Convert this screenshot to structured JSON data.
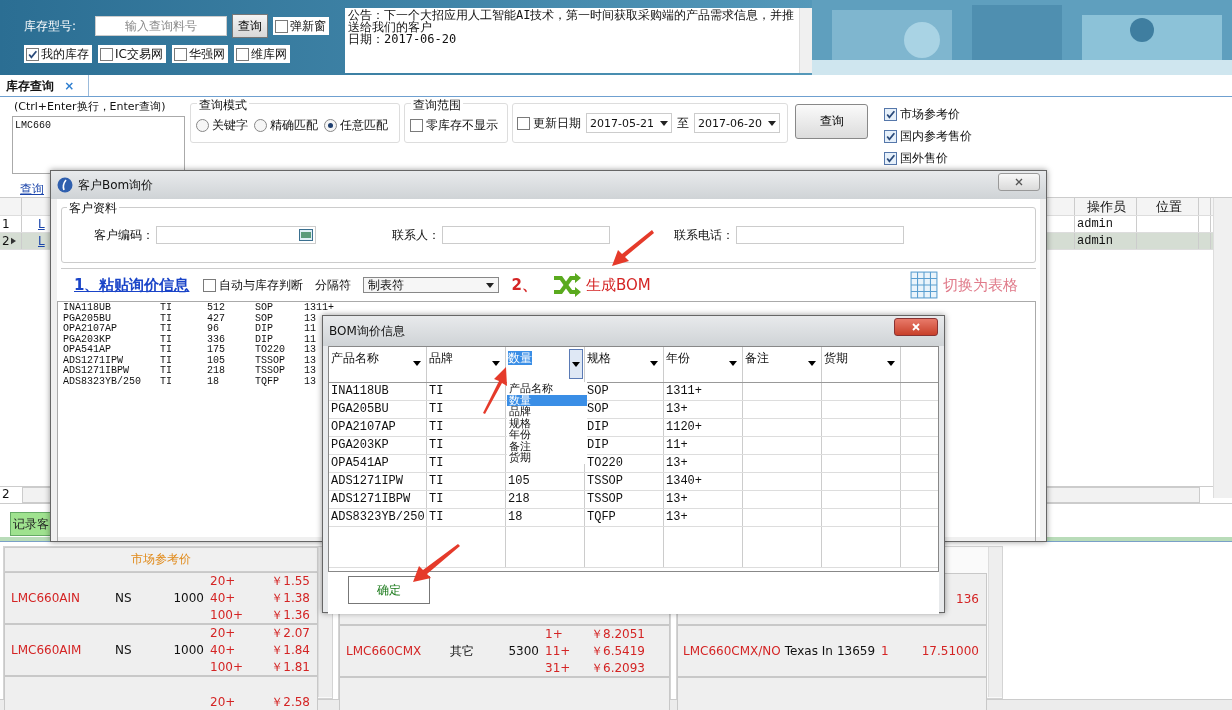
{
  "banner": {
    "model_label": "库存型号:",
    "search": {
      "placeholder": "输入查询料号"
    },
    "search_button": "查询",
    "popup": {
      "label": "弹新窗",
      "checked": false
    },
    "sources": [
      {
        "label": "我的库存",
        "checked": true
      },
      {
        "label": "IC交易网",
        "checked": false
      },
      {
        "label": "华强网",
        "checked": false
      },
      {
        "label": "维库网",
        "checked": false
      }
    ],
    "notice": "公告：下一个大招应用人工智能AI技术，第一时间获取采购端的产品需求信息，并推送给我们的客户",
    "notice_date": "日期：2017-06-20"
  },
  "tabs": [
    {
      "label": "库存查询",
      "selected": true,
      "close": "×"
    }
  ],
  "query": {
    "hint": "(Ctrl+Enter换行，Enter查询)",
    "input": "LMC660",
    "history_link": "查询",
    "mode": {
      "title": "查询模式",
      "options": [
        {
          "label": "关键字",
          "selected": false
        },
        {
          "label": "精确匹配",
          "selected": false
        },
        {
          "label": "任意匹配",
          "selected": true
        }
      ]
    },
    "scope": {
      "title": "查询范围",
      "zero_hidden": {
        "label": "零库存不显示",
        "checked": false
      }
    },
    "date": {
      "label": "更新日期",
      "checked": false,
      "from": "2017-05-21",
      "sep": "至",
      "to": "2017-06-20"
    },
    "button": "查询",
    "price_options": [
      {
        "label": "市场参考价",
        "checked": true
      },
      {
        "label": "国内参考售价",
        "checked": true
      },
      {
        "label": "国外售价",
        "checked": true
      }
    ]
  },
  "grid": {
    "columns": [
      "操作员",
      "位置"
    ],
    "rows": [
      {
        "number": "1",
        "part": "L",
        "operator": "admin",
        "selected": false
      },
      {
        "number": "2",
        "part": "L",
        "operator": "admin",
        "selected": true
      }
    ],
    "footer": "2"
  },
  "record_button": "记录客",
  "bottom": {
    "market": {
      "title": "市场参考价",
      "rows": [
        {
          "name": "LMC660AIN",
          "brand": "NS",
          "qty": "1000",
          "tiers": [
            {
              "qty": "20+",
              "price": "￥1.55"
            },
            {
              "qty": "40+",
              "price": "￥1.38"
            },
            {
              "qty": "100+",
              "price": "￥1.36"
            }
          ]
        },
        {
          "name": "LMC660AIM",
          "brand": "NS",
          "qty": "1000",
          "tiers": [
            {
              "qty": "20+",
              "price": "￥2.07"
            },
            {
              "qty": "40+",
              "price": "￥1.84"
            },
            {
              "qty": "100+",
              "price": "￥1.81"
            }
          ]
        },
        {
          "tiers": [
            {
              "qty": "20+",
              "price": "￥2.58"
            }
          ]
        }
      ]
    },
    "domestic": {
      "rows": [
        {
          "tiers": []
        },
        {
          "name": "LMC660CMX",
          "brand": "其它",
          "qty": "5300",
          "tiers": [
            {
              "qty": "1+",
              "price": "￥8.2051"
            },
            {
              "qty": "11+",
              "price": "￥6.5419"
            },
            {
              "qty": "31+",
              "price": "￥6.2093"
            }
          ]
        },
        {
          "tiers": []
        }
      ]
    },
    "foreign": {
      "rows": [
        {
          "price": "136"
        },
        {
          "name": "LMC660CMX/NO",
          "brand": "Texas In",
          "qty": "13659",
          "tier": "1",
          "price": "17.51000"
        },
        {}
      ]
    }
  },
  "customer_dialog": {
    "title": "客户Bom询价",
    "group_title": "客户资料",
    "fields": [
      {
        "label": "客户编码：",
        "kind": "lookup"
      },
      {
        "label": "联系人：",
        "kind": "text"
      },
      {
        "label": "联系电话：",
        "kind": "text"
      }
    ],
    "paste_link": "1、粘贴询价信息",
    "auto_check": {
      "label": "自动与库存判断",
      "checked": false
    },
    "separator_label": "分隔符",
    "separator": "制表符",
    "step2": "2、",
    "generate": "生成BOM",
    "switch": "切换为表格",
    "pasted_rows": [
      {
        "name": "INA118UB",
        "brand": "TI",
        "qty": "512",
        "pkg": "SOP",
        "year": "1311+"
      },
      {
        "name": "PGA205BU",
        "brand": "TI",
        "qty": "427",
        "pkg": "SOP",
        "year": "13"
      },
      {
        "name": "OPA2107AP",
        "brand": "TI",
        "qty": "96",
        "pkg": "DIP",
        "year": "11"
      },
      {
        "name": "PGA203KP",
        "brand": "TI",
        "qty": "336",
        "pkg": "DIP",
        "year": "11"
      },
      {
        "name": "OPA541AP",
        "brand": "TI",
        "qty": "175",
        "pkg": "TO220",
        "year": "13"
      },
      {
        "name": "ADS1271IPW",
        "brand": "TI",
        "qty": "105",
        "pkg": "TSSOP",
        "year": "13"
      },
      {
        "name": "ADS1271IBPW",
        "brand": "TI",
        "qty": "218",
        "pkg": "TSSOP",
        "year": "13"
      },
      {
        "name": "ADS8323YB/250",
        "brand": "TI",
        "qty": "18",
        "pkg": "TQFP",
        "year": "13"
      }
    ]
  },
  "bom_dialog": {
    "title": "BOM询价信息",
    "columns": [
      {
        "label": "产品名称",
        "selected": false
      },
      {
        "label": "品牌",
        "selected": false
      },
      {
        "label": "数量",
        "selected": true
      },
      {
        "label": "规格",
        "selected": false
      },
      {
        "label": "年份",
        "selected": false
      },
      {
        "label": "备注",
        "selected": false
      },
      {
        "label": "货期",
        "selected": false
      }
    ],
    "rows": [
      {
        "name": "INA118UB",
        "brand": "TI",
        "spec": "SOP",
        "year": "1311+"
      },
      {
        "name": "PGA205BU",
        "brand": "TI",
        "spec": "SOP",
        "year": "13+"
      },
      {
        "name": "OPA2107AP",
        "brand": "TI",
        "spec": "DIP",
        "year": "1120+"
      },
      {
        "name": "PGA203KP",
        "brand": "TI",
        "spec": "DIP",
        "year": "11+"
      },
      {
        "name": "OPA541AP",
        "brand": "TI",
        "spec": "TO220",
        "year": "13+"
      },
      {
        "name": "ADS1271IPW",
        "brand": "TI",
        "qty": "105",
        "spec": "TSSOP",
        "year": "1340+"
      },
      {
        "name": "ADS1271IBPW",
        "brand": "TI",
        "qty": "218",
        "spec": "TSSOP",
        "year": "13+"
      },
      {
        "name": "ADS8323YB/250",
        "brand": "TI",
        "qty": "18",
        "spec": "TQFP",
        "year": "13+"
      }
    ],
    "dropdown": [
      {
        "label": "产品名称",
        "selected": false
      },
      {
        "label": "数量",
        "selected": true
      },
      {
        "label": "品牌",
        "selected": false
      },
      {
        "label": "规格",
        "selected": false
      },
      {
        "label": "年份",
        "selected": false
      },
      {
        "label": "备注",
        "selected": false
      },
      {
        "label": "货期",
        "selected": false
      }
    ],
    "confirm": "确定"
  }
}
